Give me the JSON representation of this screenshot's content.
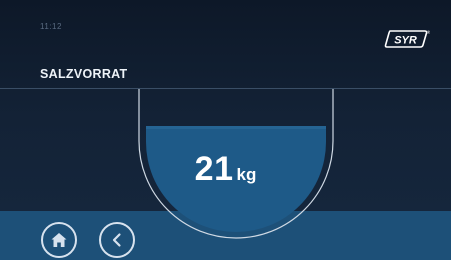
{
  "status_bar": {
    "time": "11:12"
  },
  "brand": {
    "logo_text": "SYR",
    "registered_mark": "®"
  },
  "page": {
    "title": "SALZVORRAT"
  },
  "salt_level": {
    "value": "21",
    "unit": "kg"
  },
  "navigation": {
    "home_icon": "home-icon",
    "back_icon": "chevron-left-icon"
  },
  "colors": {
    "background": "#132236",
    "accent": "#1d5078",
    "fill": "#1e5a88",
    "outline": "#cfd9e4"
  }
}
